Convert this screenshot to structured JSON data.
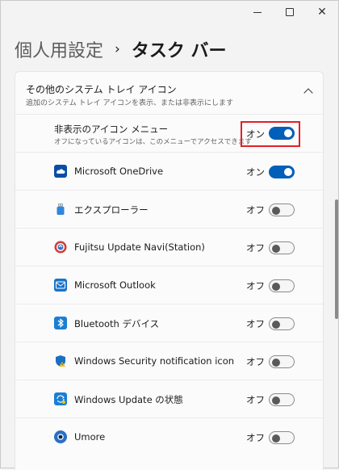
{
  "window": {
    "close_glyph": "✕"
  },
  "breadcrumb": {
    "parent": "個人用設定",
    "separator": "›",
    "current": "タスク バー"
  },
  "section": {
    "title": "その他のシステム トレイ アイコン",
    "subtitle": "追加のシステム トレイ アイコンを表示、または非表示にします",
    "expanded": true
  },
  "hidden_menu": {
    "label": "非表示のアイコン メニュー",
    "description": "オフになっているアイコンは、このメニューでアクセスできます",
    "state_label": "オン",
    "on": true
  },
  "items": [
    {
      "label": "Microsoft OneDrive",
      "state_label": "オン",
      "on": true,
      "icon": "onedrive-icon",
      "color": "#0a4ea3"
    },
    {
      "label": "エクスプローラー",
      "state_label": "オフ",
      "on": false,
      "icon": "usb-drive-icon",
      "color": "#1a7fd4"
    },
    {
      "label": "Fujitsu Update Navi(Station)",
      "state_label": "オフ",
      "on": false,
      "icon": "fujitsu-update-icon",
      "color": "#c8322d"
    },
    {
      "label": "Microsoft Outlook",
      "state_label": "オフ",
      "on": false,
      "icon": "outlook-icon",
      "color": "#1a73c9"
    },
    {
      "label": "Bluetooth デバイス",
      "state_label": "オフ",
      "on": false,
      "icon": "bluetooth-icon",
      "color": "#1a7fd4"
    },
    {
      "label": "Windows Security notification icon",
      "state_label": "オフ",
      "on": false,
      "icon": "windows-security-icon",
      "color": "#1a6fc4"
    },
    {
      "label": "Windows Update の状態",
      "state_label": "オフ",
      "on": false,
      "icon": "windows-update-icon",
      "color": "#1a7fd4"
    },
    {
      "label": "Umore",
      "state_label": "オフ",
      "on": false,
      "icon": "umore-icon",
      "color": "#2a6fc4"
    }
  ],
  "colors": {
    "accent": "#005fb8",
    "highlight": "#e0202a"
  }
}
